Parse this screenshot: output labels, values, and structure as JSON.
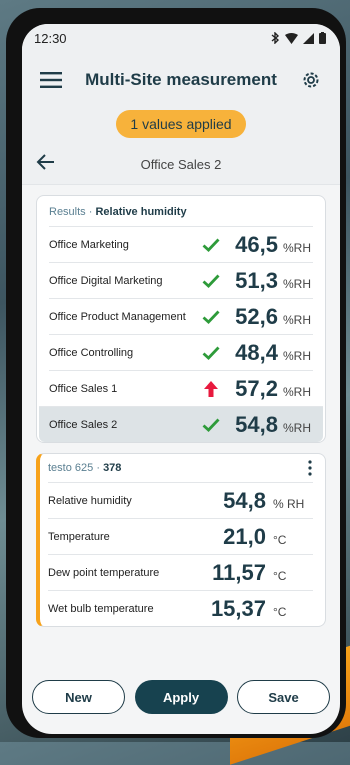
{
  "colors": {
    "accent": "#f7a21a",
    "primary": "#17424f",
    "check": "#2e9b3a",
    "alarm": "#e8193e"
  },
  "status": {
    "time": "12:30",
    "icons": [
      "bluetooth-icon",
      "wifi-icon",
      "signal-icon",
      "battery-icon"
    ]
  },
  "appbar": {
    "title": "Multi-Site measurement",
    "menu_icon": "hamburger-icon",
    "settings_icon": "gear-icon"
  },
  "applied_badge": "1 values applied",
  "nav": {
    "back_icon": "arrow-left-icon",
    "site": "Office Sales 2"
  },
  "results": {
    "label": "Results",
    "separator": "·",
    "parameter": "Relative humidity",
    "rows": [
      {
        "name": "Office Marketing",
        "status": "ok",
        "value": "46,5",
        "unit": "%RH"
      },
      {
        "name": "Office Digital Marketing",
        "status": "ok",
        "value": "51,3",
        "unit": "%RH"
      },
      {
        "name": "Office Product Management",
        "status": "ok",
        "value": "52,6",
        "unit": "%RH"
      },
      {
        "name": "Office Controlling",
        "status": "ok",
        "value": "48,4",
        "unit": "%RH"
      },
      {
        "name": "Office Sales 1",
        "status": "high",
        "value": "57,2",
        "unit": "%RH"
      },
      {
        "name": "Office Sales 2",
        "status": "ok",
        "value": "54,8",
        "unit": "%RH",
        "selected": true
      }
    ]
  },
  "probe": {
    "model": "testo 625",
    "separator": "·",
    "serial": "378",
    "more_icon": "kebab-menu-icon",
    "rows": [
      {
        "name": "Relative humidity",
        "value": "54,8",
        "unit": "% RH"
      },
      {
        "name": "Temperature",
        "value": "21,0",
        "unit": "°C"
      },
      {
        "name": "Dew point temperature",
        "value": "11,57",
        "unit": "°C"
      },
      {
        "name": "Wet bulb temperature",
        "value": "15,37",
        "unit": "°C"
      }
    ]
  },
  "buttons": {
    "new": "New",
    "apply": "Apply",
    "save": "Save"
  }
}
